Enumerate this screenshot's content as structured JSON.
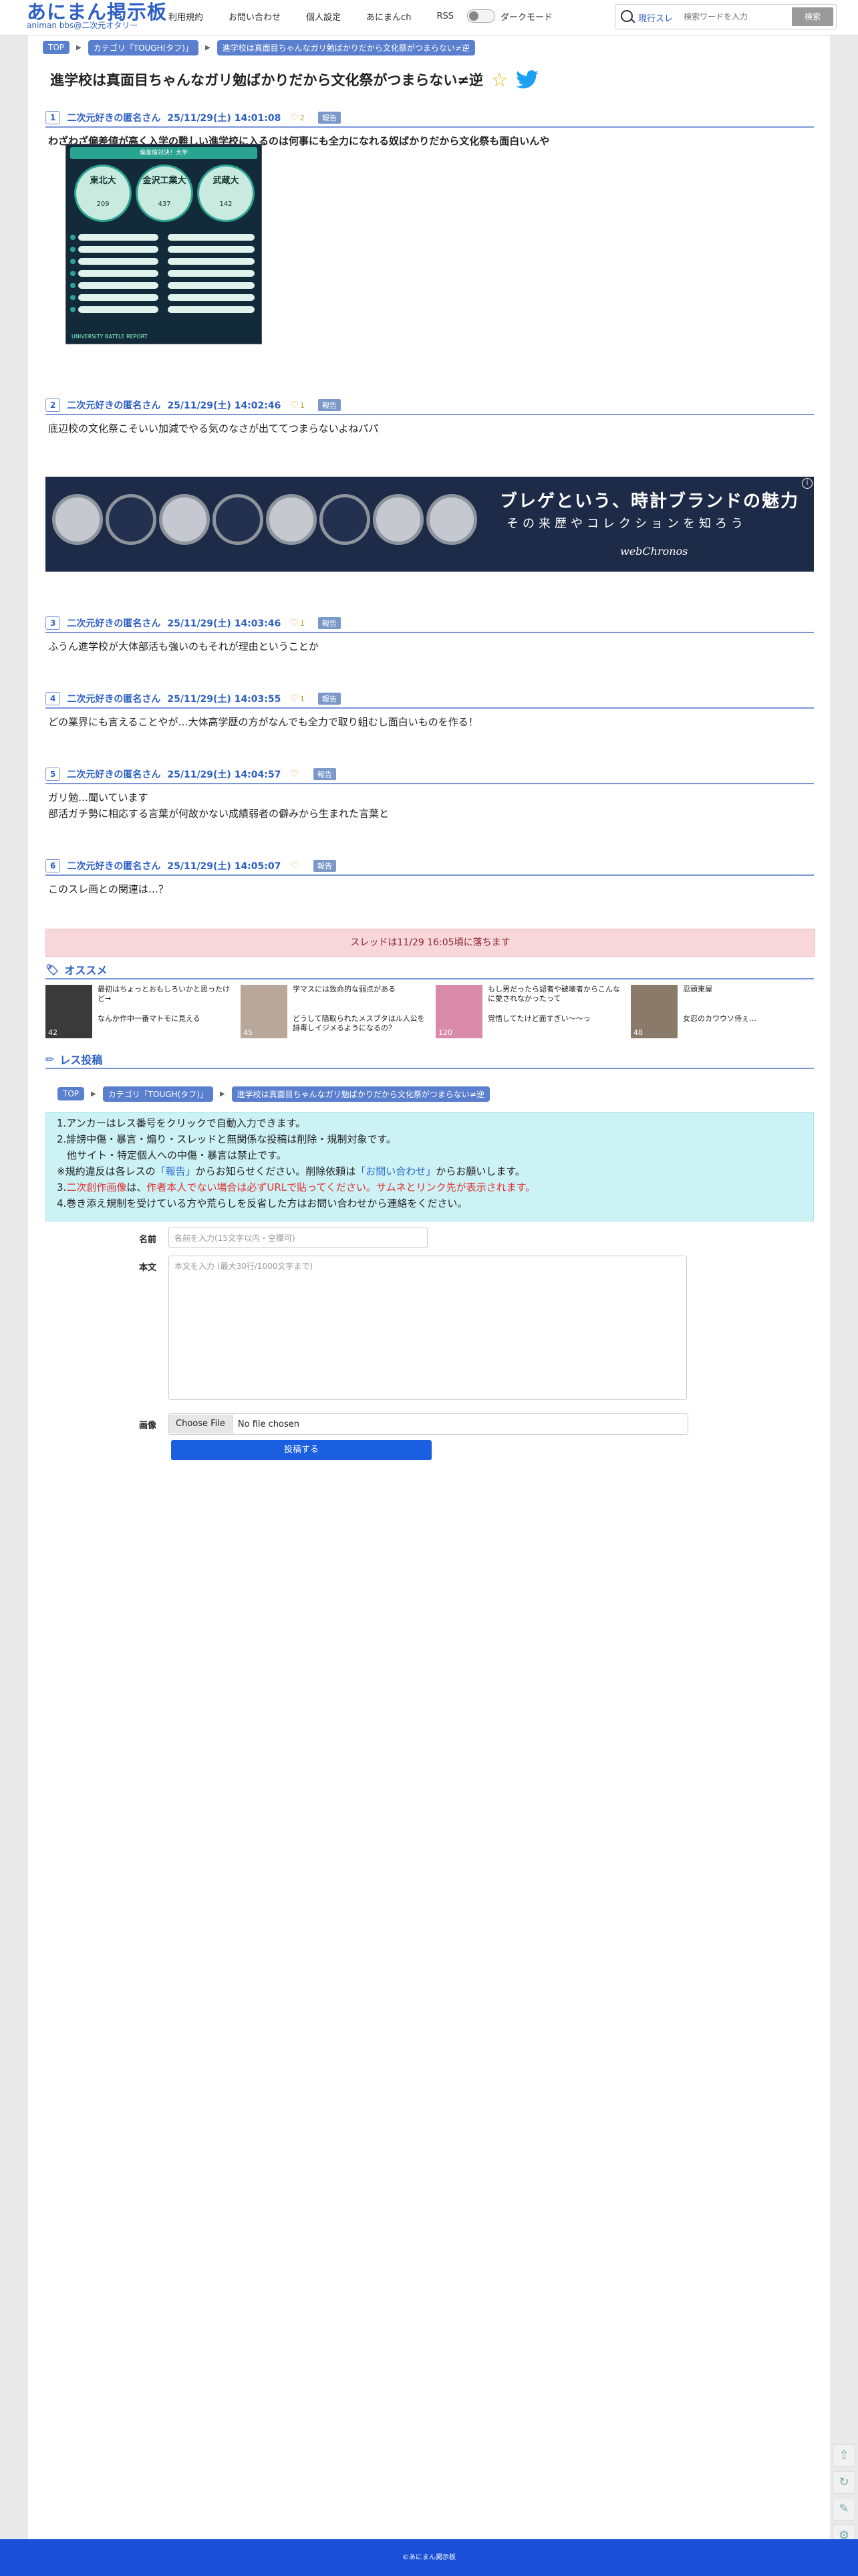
{
  "header": {
    "logo": "あにまん掲示板",
    "logo_sub": "animan bbs@二次元オタリー",
    "nav": [
      "利用規約",
      "お問い合わせ",
      "個人設定",
      "あにまんch",
      "RSS"
    ],
    "dark_mode": "ダークモード",
    "search_label": "現行スレ",
    "search_placeholder": "検索ワードを入力",
    "search_button": "検索"
  },
  "breadcrumb": {
    "top": "TOP",
    "category": "カテゴリ「TOUGH(タフ)」",
    "thread": "進学校は真面目ちゃんなガリ勉ばかりだから文化祭がつまらない≠逆"
  },
  "thread_title": "進学校は真面目ちゃんなガリ勉ばかりだから文化祭がつまらない≠逆",
  "posts": [
    {
      "num": "1",
      "name": "二次元好きの匿名さん",
      "date": "25/11/29(土) 14:01:08",
      "likes": "2",
      "report": "報告",
      "body": [
        "わざわざ偏差値が高く入学の難しい進学校に入るのは何事にも全力になれる奴ばかりだから文化祭も面白いんや"
      ]
    },
    {
      "num": "2",
      "name": "二次元好きの匿名さん",
      "date": "25/11/29(土) 14:02:46",
      "likes": "1",
      "report": "報告",
      "body": [
        "底辺校の文化祭こそいい加減でやる気のなさが出ててつまらないよねパパ"
      ]
    },
    {
      "num": "3",
      "name": "二次元好きの匿名さん",
      "date": "25/11/29(土) 14:03:46",
      "likes": "1",
      "report": "報告",
      "body": [
        "ふうん進学校が大体部活も強いのもそれが理由ということか"
      ]
    },
    {
      "num": "4",
      "name": "二次元好きの匿名さん",
      "date": "25/11/29(土) 14:03:55",
      "likes": "1",
      "report": "報告",
      "body": [
        "どの業界にも言えることやが…大体高学歴の方がなんでも全力で取り組むし面白いものを作る！"
      ]
    },
    {
      "num": "5",
      "name": "二次元好きの匿名さん",
      "date": "25/11/29(土) 14:04:57",
      "likes": "",
      "report": "報告",
      "body": [
        "ガリ勉…聞いています",
        "部活ガチ勢に相応する言葉が何故かない成績弱者の僻みから生まれた言葉と"
      ]
    },
    {
      "num": "6",
      "name": "二次元好きの匿名さん",
      "date": "25/11/29(土) 14:05:07",
      "likes": "",
      "report": "報告",
      "body": [
        "このスレ画との関連は…？"
      ]
    }
  ],
  "post_image": {
    "header": "偏差値対決！大学",
    "circles": [
      {
        "name": "東北大",
        "value": "209"
      },
      {
        "name": "金沢工業大",
        "value": "437"
      },
      {
        "name": "武蔵大",
        "value": "142"
      }
    ],
    "footer": "UNIVERSITY BATTLE REPORT"
  },
  "ad": {
    "headline": "ブレゲという、時計ブランドの魅力",
    "sub": "その来歴やコレクションを知ろう",
    "brand": "webChronos",
    "info": "i"
  },
  "closed_notice": "スレッドは11/29 16:05頃に落ちます",
  "recommend": {
    "heading": "オススメ",
    "items": [
      {
        "title": "最初はちょっとおもしろいかと思ったけど→",
        "sub": "なんか作中一番マトモに見える",
        "count": "42"
      },
      {
        "title": "学マスには致命的な弱点がある",
        "sub": "どうして隠取られたメスブタはル人公を誹毒しイジメるようになるの？",
        "count": "45"
      },
      {
        "title": "もし男だったら認者や破壊者からこんなに愛されなかったって",
        "sub": "覚悟してたけど面すぎい〜〜っ",
        "count": "120"
      },
      {
        "title": "忍頭東屋",
        "sub": "女忍のカワウソ侍ぇ…",
        "count": "48"
      }
    ]
  },
  "reply": {
    "heading": "レス投稿",
    "rules": [
      "1.アンカーはレス番号をクリックで自動入力できます。",
      "2.誹謗中傷・暴言・煽り・スレッドと無関係な投稿は削除・規制対象です。",
      "　他サイト・特定個人への中傷・暴言は禁止です。",
      "※規約違反は各レスの「報告」からお知らせください。削除依頼は「お問い合わせ」からお願いします。",
      "3.二次創作画像は、作者本人でない場合は必ずURLで貼ってください。サムネとリンク先が表示されます。",
      "4.巻き添え規制を受けている方や荒らしを反省した方はお問い合わせから連絡をください。"
    ],
    "rule4_prefix": "※規約違反は各レスの",
    "rule4_report": "「報告」",
    "rule4_mid": "からお知らせください。削除依頼は",
    "rule4_contact": "「お問い合わせ」",
    "rule4_suffix": "からお願いします。",
    "rule5_prefix": "3.",
    "rule5_red1": "二次創作画像",
    "rule5_mid": "は、",
    "rule5_red2": "作者本人でない場合は必ずURLで貼ってください。サムネとリンク先が表示されます。",
    "name_label": "名前",
    "name_placeholder": "名前を入力(15文字以内・空欄可)",
    "body_label": "本文",
    "body_placeholder": "本文を入力 (最大30行/1000文字まで)",
    "image_label": "画像",
    "file_button": "Choose File",
    "file_status": "No file chosen",
    "submit": "投稿する"
  },
  "footer": "©あにまん掲示板"
}
